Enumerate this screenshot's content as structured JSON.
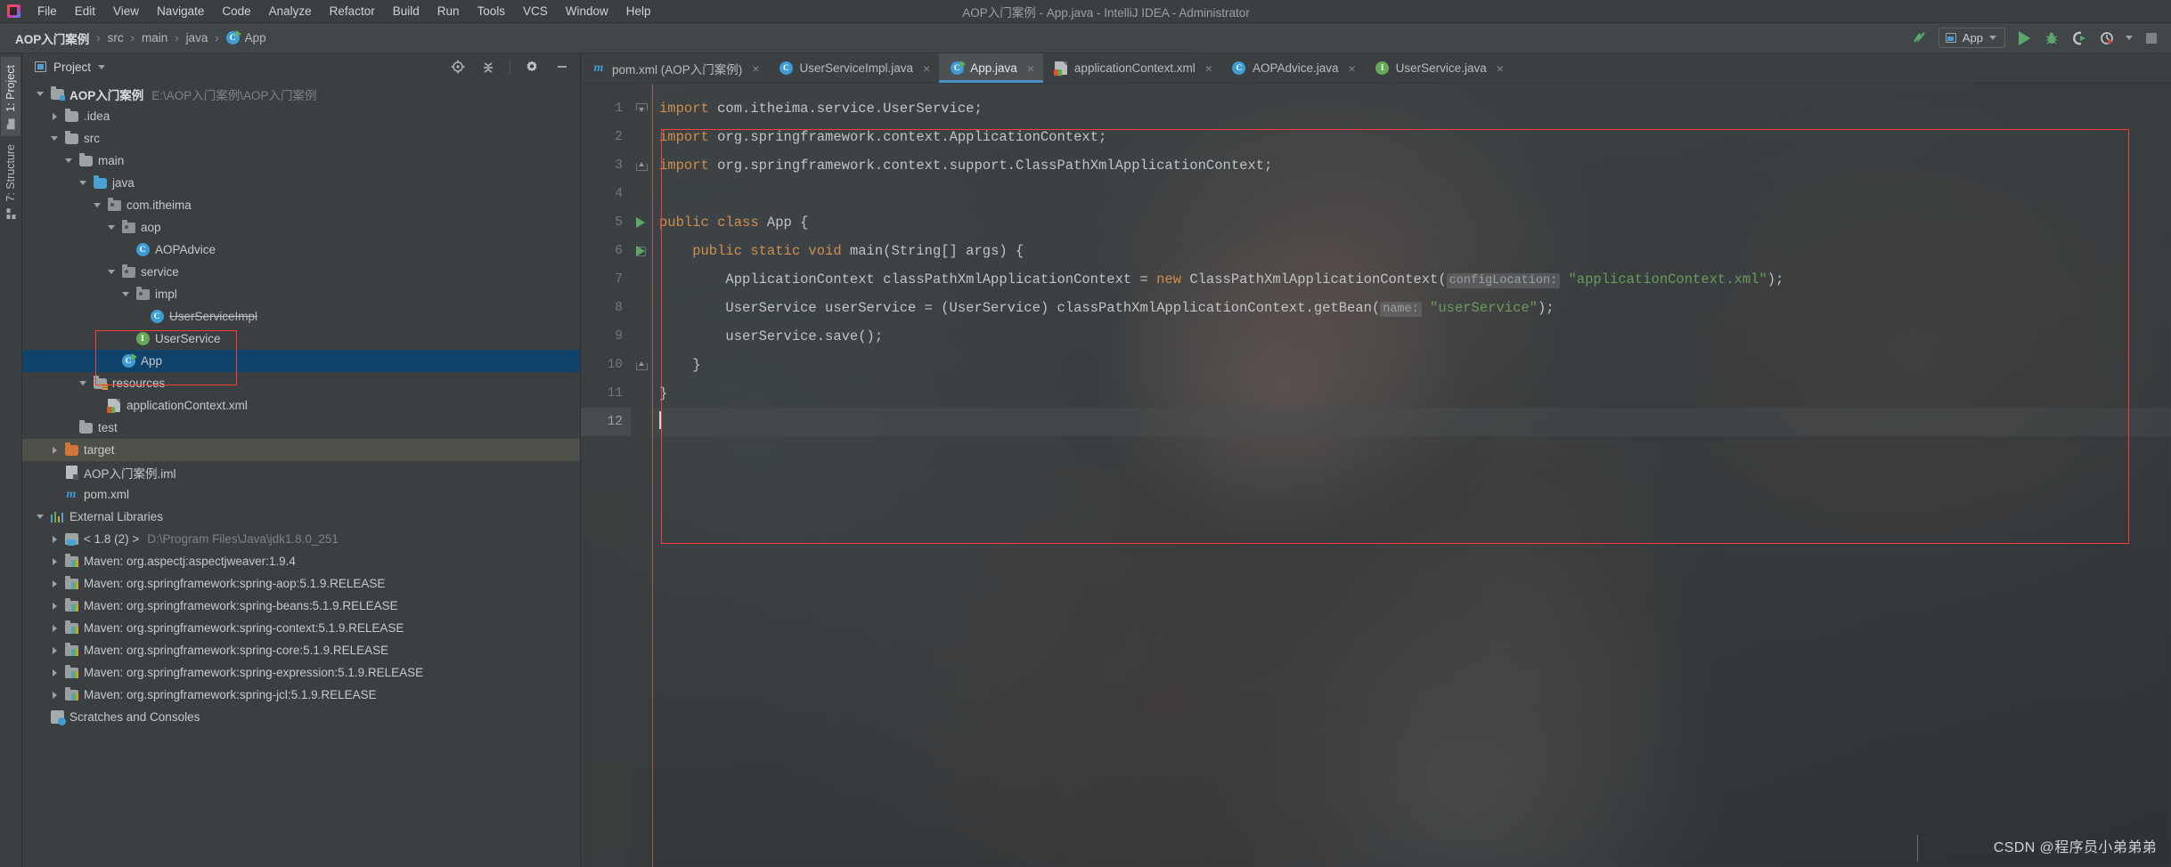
{
  "window": {
    "title": "AOP入门案例 - App.java - IntelliJ IDEA - Administrator",
    "logo_icon": "intellij-idea-logo"
  },
  "menu": [
    {
      "label": "File"
    },
    {
      "label": "Edit"
    },
    {
      "label": "View"
    },
    {
      "label": "Navigate"
    },
    {
      "label": "Code"
    },
    {
      "label": "Analyze"
    },
    {
      "label": "Refactor"
    },
    {
      "label": "Build"
    },
    {
      "label": "Run"
    },
    {
      "label": "Tools"
    },
    {
      "label": "VCS"
    },
    {
      "label": "Window"
    },
    {
      "label": "Help"
    }
  ],
  "breadcrumb": {
    "items": [
      {
        "label": "AOP入门案例",
        "icon": "project-icon"
      },
      {
        "label": "src",
        "icon": "folder-icon"
      },
      {
        "label": "main",
        "icon": "folder-icon"
      },
      {
        "label": "java",
        "icon": "folder-icon"
      },
      {
        "label": "App",
        "icon": "java-class-runnable-icon"
      }
    ],
    "separator": "›"
  },
  "toolbar": {
    "update_icon": "update-project-icon",
    "run_config": {
      "label": "App",
      "icon": "run-config-icon",
      "caret": "chevron-down-icon"
    },
    "run_icon": "run-icon",
    "debug_icon": "debug-bug-icon",
    "coverage_icon": "run-with-coverage-icon",
    "profile_icon": "profiler-icon",
    "profile_caret": "chevron-down-icon",
    "stop_icon": "stop-icon"
  },
  "side_tabs": [
    {
      "label": "1: Project",
      "icon": "project-panel-icon",
      "active": true
    },
    {
      "label": "7: Structure",
      "icon": "structure-panel-icon",
      "active": false
    }
  ],
  "project_panel": {
    "title": "Project",
    "title_caret": "chevron-down-icon",
    "actions": [
      {
        "name": "locate-icon"
      },
      {
        "name": "collapse-all-icon"
      },
      {
        "name": "gear-icon"
      },
      {
        "name": "hide-icon"
      }
    ],
    "tree": [
      {
        "depth": 0,
        "arrow": "open",
        "icon": "project-root-icon",
        "label": "AOP入门案例",
        "sublabel": "E:\\AOP入门案例\\AOP入门案例",
        "bold": true
      },
      {
        "depth": 1,
        "arrow": "closed",
        "icon": "folder-icon",
        "label": ".idea"
      },
      {
        "depth": 1,
        "arrow": "open",
        "icon": "folder-icon",
        "label": "src"
      },
      {
        "depth": 2,
        "arrow": "open",
        "icon": "folder-icon",
        "label": "main"
      },
      {
        "depth": 3,
        "arrow": "open",
        "icon": "source-folder-icon",
        "label": "java"
      },
      {
        "depth": 4,
        "arrow": "open",
        "icon": "package-icon",
        "label": "com.itheima"
      },
      {
        "depth": 5,
        "arrow": "open",
        "icon": "package-icon",
        "label": "aop"
      },
      {
        "depth": 6,
        "arrow": "none",
        "icon": "java-class-icon",
        "label": "AOPAdvice"
      },
      {
        "depth": 5,
        "arrow": "open",
        "icon": "package-icon",
        "label": "service"
      },
      {
        "depth": 6,
        "arrow": "open",
        "icon": "package-icon",
        "label": "impl"
      },
      {
        "depth": 7,
        "arrow": "none",
        "icon": "java-class-icon",
        "label": "UserServiceImpl",
        "strike": true
      },
      {
        "depth": 6,
        "arrow": "none",
        "icon": "java-interface-icon",
        "label": "UserService"
      },
      {
        "depth": 5,
        "arrow": "none",
        "icon": "java-class-runnable-icon",
        "label": "App",
        "selected": true
      },
      {
        "depth": 3,
        "arrow": "open",
        "icon": "resources-folder-icon",
        "label": "resources"
      },
      {
        "depth": 4,
        "arrow": "none",
        "icon": "xml-spring-icon",
        "label": "applicationContext.xml"
      },
      {
        "depth": 2,
        "arrow": "none",
        "icon": "folder-icon",
        "label": "test"
      },
      {
        "depth": 1,
        "arrow": "closed",
        "icon": "excluded-folder-icon",
        "label": "target",
        "highlight": true
      },
      {
        "depth": 1,
        "arrow": "none",
        "icon": "iml-file-icon",
        "label": "AOP入门案例.iml"
      },
      {
        "depth": 1,
        "arrow": "none",
        "icon": "maven-pom-icon",
        "label": "pom.xml"
      },
      {
        "depth": 0,
        "arrow": "open",
        "icon": "external-libraries-icon",
        "label": "External Libraries"
      },
      {
        "depth": 1,
        "arrow": "closed",
        "icon": "jdk-icon",
        "label": "< 1.8 (2) >",
        "sublabel": "D:\\Program Files\\Java\\jdk1.8.0_251"
      },
      {
        "depth": 1,
        "arrow": "closed",
        "icon": "maven-lib-icon",
        "label": "Maven: org.aspectj:aspectjweaver:1.9.4"
      },
      {
        "depth": 1,
        "arrow": "closed",
        "icon": "maven-lib-icon",
        "label": "Maven: org.springframework:spring-aop:5.1.9.RELEASE"
      },
      {
        "depth": 1,
        "arrow": "closed",
        "icon": "maven-lib-icon",
        "label": "Maven: org.springframework:spring-beans:5.1.9.RELEASE"
      },
      {
        "depth": 1,
        "arrow": "closed",
        "icon": "maven-lib-icon",
        "label": "Maven: org.springframework:spring-context:5.1.9.RELEASE"
      },
      {
        "depth": 1,
        "arrow": "closed",
        "icon": "maven-lib-icon",
        "label": "Maven: org.springframework:spring-core:5.1.9.RELEASE"
      },
      {
        "depth": 1,
        "arrow": "closed",
        "icon": "maven-lib-icon",
        "label": "Maven: org.springframework:spring-expression:5.1.9.RELEASE"
      },
      {
        "depth": 1,
        "arrow": "closed",
        "icon": "maven-lib-icon",
        "label": "Maven: org.springframework:spring-jcl:5.1.9.RELEASE"
      },
      {
        "depth": 0,
        "arrow": "none",
        "icon": "scratches-icon",
        "label": "Scratches and Consoles"
      }
    ]
  },
  "editor": {
    "tabs": [
      {
        "label": "pom.xml (AOP入门案例)",
        "icon": "maven-pom-icon",
        "active": false,
        "close": "×"
      },
      {
        "label": "UserServiceImpl.java",
        "icon": "java-class-icon",
        "active": false,
        "close": "×"
      },
      {
        "label": "App.java",
        "icon": "java-class-runnable-icon",
        "active": true,
        "close": "×"
      },
      {
        "label": "applicationContext.xml",
        "icon": "xml-spring-icon",
        "active": false,
        "close": "×"
      },
      {
        "label": "AOPAdvice.java",
        "icon": "java-class-icon",
        "active": false,
        "close": "×"
      },
      {
        "label": "UserService.java",
        "icon": "java-interface-icon",
        "active": false,
        "close": "×"
      }
    ],
    "line_numbers": [
      "1",
      "2",
      "3",
      "4",
      "5",
      "6",
      "7",
      "8",
      "9",
      "10",
      "11",
      "12"
    ],
    "current_line": 12,
    "code_lines": [
      [
        {
          "t": "import ",
          "c": "k"
        },
        {
          "t": "com.itheima.service.UserService",
          "c": "p"
        },
        {
          "t": ";",
          "c": "sc"
        }
      ],
      [
        {
          "t": "import ",
          "c": "k"
        },
        {
          "t": "org.springframework.context.ApplicationContext",
          "c": "p"
        },
        {
          "t": ";",
          "c": "sc"
        }
      ],
      [
        {
          "t": "import ",
          "c": "k"
        },
        {
          "t": "org.springframework.context.support.ClassPathXmlApplicationContext",
          "c": "p"
        },
        {
          "t": ";",
          "c": "sc"
        }
      ],
      [],
      [
        {
          "t": "public class ",
          "c": "k"
        },
        {
          "t": "App {",
          "c": "p"
        }
      ],
      [
        {
          "t": "    public static void ",
          "c": "k"
        },
        {
          "t": "main(String[] args) {",
          "c": "p"
        }
      ],
      [
        {
          "t": "        ApplicationContext classPathXmlApplicationContext = ",
          "c": "p"
        },
        {
          "t": "new ",
          "c": "k"
        },
        {
          "t": "ClassPathXmlApplicationContext(",
          "c": "p"
        },
        {
          "t": "configLocation:",
          "c": "hint"
        },
        {
          "t": " \"applicationContext.xml\"",
          "c": "s"
        },
        {
          "t": ");",
          "c": "p"
        }
      ],
      [
        {
          "t": "        UserService userService = (UserService) classPathXmlApplicationContext.getBean(",
          "c": "p"
        },
        {
          "t": "name:",
          "c": "hint"
        },
        {
          "t": " \"userService\"",
          "c": "s"
        },
        {
          "t": ");",
          "c": "p"
        }
      ],
      [
        {
          "t": "        userService.save();",
          "c": "p"
        }
      ],
      [
        {
          "t": "    }",
          "c": "p"
        }
      ],
      [
        {
          "t": "}",
          "c": "p"
        }
      ],
      []
    ]
  },
  "watermark": {
    "text": "CSDN @程序员小弟弟弟"
  },
  "colors": {
    "accent": "#4a90c4",
    "annotation_red": "#f2403a",
    "selection_blue": "#10436b",
    "keyword_orange": "#cf8e4b",
    "string_green": "#6a9b5b",
    "run_green": "#59a869"
  }
}
